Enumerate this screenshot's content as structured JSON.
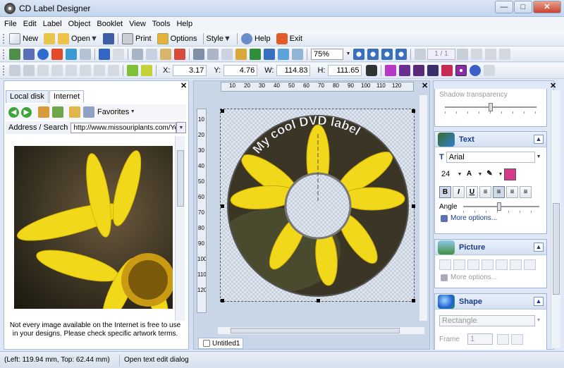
{
  "window": {
    "title": "CD Label Designer"
  },
  "menu": [
    "File",
    "Edit",
    "Label",
    "Object",
    "Booklet",
    "View",
    "Tools",
    "Help"
  ],
  "toolbar1": {
    "new_label": "New",
    "open_label": "Open",
    "print_label": "Print",
    "options_label": "Options",
    "style_label": "Style",
    "help_label": "Help",
    "exit_label": "Exit"
  },
  "toolbar2": {
    "zoom": "75%",
    "page": "1 / 1"
  },
  "toolbar3": {
    "x_label": "X:",
    "x_value": "3.17",
    "y_label": "Y:",
    "y_value": "4.76",
    "w_label": "W:",
    "w_value": "114.83",
    "h_label": "H:",
    "h_value": "111.65"
  },
  "left_panel": {
    "tabs": [
      "Local disk",
      "Internet"
    ],
    "active_tab": "Internet",
    "favorites_label": "Favorites",
    "address_label": "Address / Search",
    "address_value": "http://www.missouriplants.com/Yell",
    "notice": "Not every image available on the Internet is free to use in your designs. Please check specific artwork terms."
  },
  "canvas": {
    "label_text": "My cool DVD label",
    "ruler_top": [
      "10",
      "20",
      "30",
      "40",
      "50",
      "60",
      "70",
      "80",
      "90",
      "100",
      "110",
      "120"
    ],
    "ruler_left": [
      "10",
      "20",
      "30",
      "40",
      "50",
      "60",
      "70",
      "80",
      "90",
      "100",
      "110",
      "120"
    ],
    "doc_tab": "Untitled1"
  },
  "right_panel": {
    "shadow_transparency_label": "Shadow transparency",
    "text_group": {
      "title": "Text",
      "font": "Arial",
      "size": "24",
      "style_buttons": [
        "B",
        "I",
        "U"
      ],
      "angle_label": "Angle",
      "more_options": "More options..."
    },
    "picture_group": {
      "title": "Picture",
      "more_options": "More options..."
    },
    "shape_group": {
      "title": "Shape",
      "shape_value": "Rectangle",
      "frame_label": "Frame",
      "frame_value": "1"
    }
  },
  "status": {
    "position": "(Left: 119.94 mm, Top: 62.44 mm)",
    "hint": "Open text edit dialog"
  },
  "colors": {
    "accent": "#1b3b8a",
    "petal": "#f2d81a",
    "panel": "#dfe8f6"
  }
}
